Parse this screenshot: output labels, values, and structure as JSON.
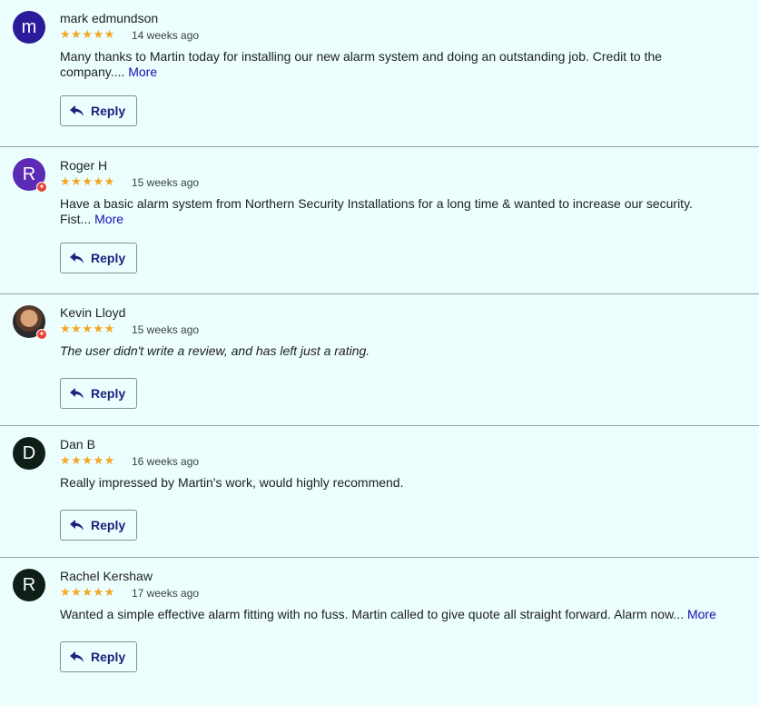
{
  "reviews": [
    {
      "avatar_letter": "m",
      "avatar_color": "#2b1a99",
      "name": "mark edmundson",
      "stars": "★★★★★",
      "time": "14 weeks ago",
      "text": "Many thanks to Martin today for installing our new alarm system and doing an outstanding job. Credit to the company....",
      "more_label": "More",
      "reply_label": "Reply"
    },
    {
      "avatar_letter": "R",
      "avatar_color": "#5b2bb5",
      "name": "Roger H",
      "stars": "★★★★★",
      "time": "15 weeks ago",
      "text": "Have a basic alarm system from Northern Security Installations for a long time & wanted to increase our security. Fist...",
      "more_label": "More",
      "reply_label": "Reply"
    },
    {
      "name": "Kevin Lloyd",
      "stars": "★★★★★",
      "time": "15 weeks ago",
      "text": "The user didn't write a review, and has left just a rating.",
      "reply_label": "Reply"
    },
    {
      "avatar_letter": "D",
      "avatar_color": "#0f1f17",
      "name": "Dan B",
      "stars": "★★★★★",
      "time": "16 weeks ago",
      "text": "Really impressed by Martin's work, would highly recommend.",
      "reply_label": "Reply"
    },
    {
      "avatar_letter": "R",
      "avatar_color": "#0f1f17",
      "name": "Rachel Kershaw",
      "stars": "★★★★★",
      "time": "17 weeks ago",
      "text": "Wanted a simple effective alarm fitting with no fuss. Martin called to give quote all straight forward. Alarm now...",
      "more_label": "More",
      "reply_label": "Reply"
    }
  ],
  "colors": {
    "background": "#ecfefe",
    "star": "#f5a623",
    "link": "#1a0dab",
    "reply_text": "#1a237e"
  }
}
